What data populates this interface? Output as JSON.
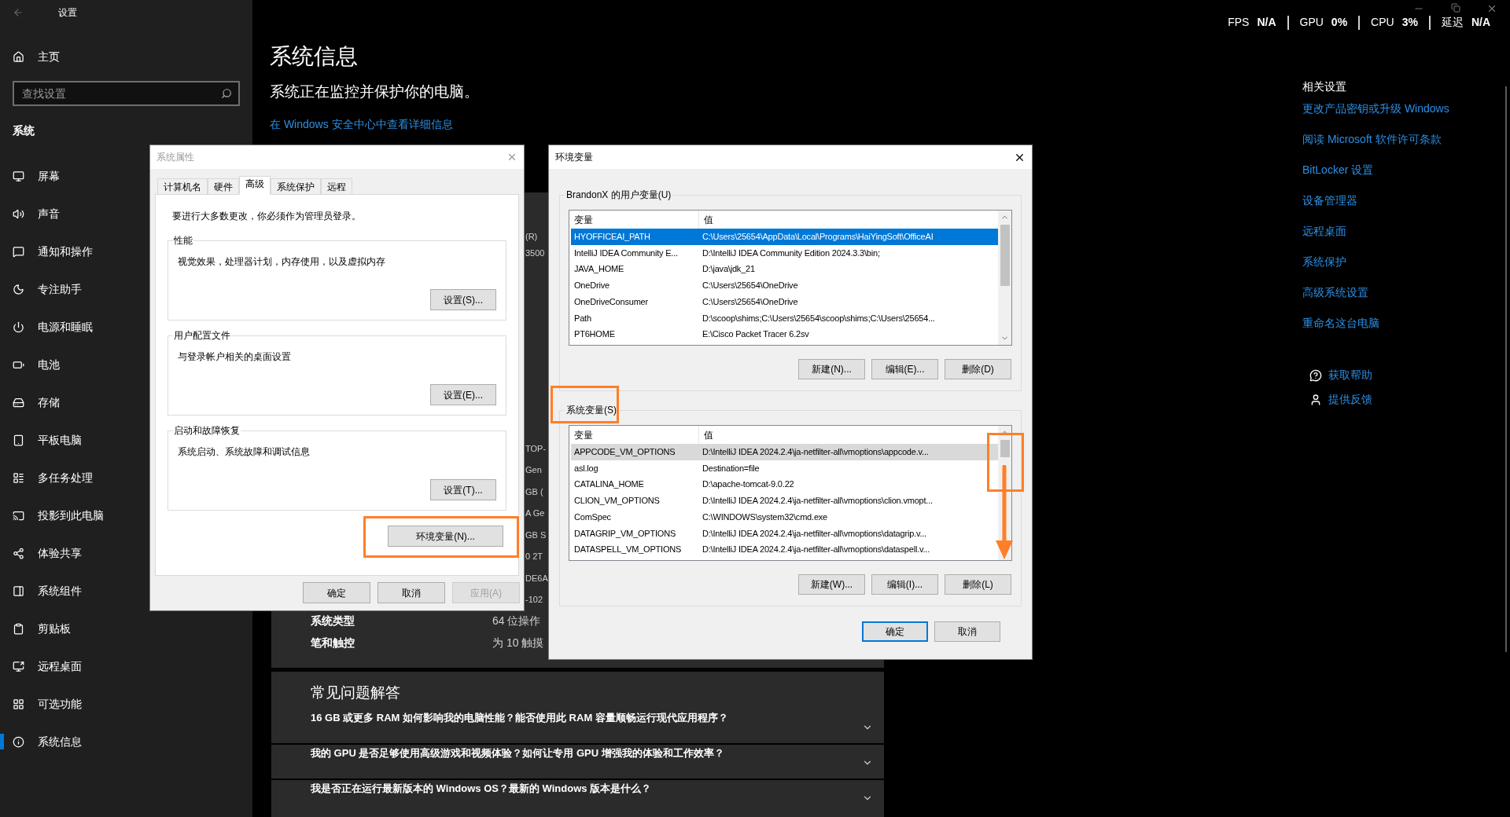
{
  "settings_window": {
    "title": "设置"
  },
  "sidebar": {
    "home": "主页",
    "search": {
      "placeholder": "查找设置"
    },
    "section": "系统",
    "items": [
      {
        "label": "屏幕",
        "selected": false
      },
      {
        "label": "声音",
        "selected": false
      },
      {
        "label": "通知和操作",
        "selected": false
      },
      {
        "label": "专注助手",
        "selected": false
      },
      {
        "label": "电源和睡眠",
        "selected": false
      },
      {
        "label": "电池",
        "selected": false
      },
      {
        "label": "存储",
        "selected": false
      },
      {
        "label": "平板电脑",
        "selected": false
      },
      {
        "label": "多任务处理",
        "selected": false
      },
      {
        "label": "投影到此电脑",
        "selected": false
      },
      {
        "label": "体验共享",
        "selected": false
      },
      {
        "label": "系统组件",
        "selected": false
      },
      {
        "label": "剪贴板",
        "selected": false
      },
      {
        "label": "远程桌面",
        "selected": false
      },
      {
        "label": "可选功能",
        "selected": false
      },
      {
        "label": "系统信息",
        "selected": true
      }
    ]
  },
  "page": {
    "title": "系统信息",
    "subtitle": "系统正在监控并保护你的电脑。",
    "link": "在 Windows 安全中心中查看详细信息"
  },
  "spec_card": {
    "clipped_values": [
      "(R)",
      "3500",
      "TOP-",
      "Gen",
      "GB (",
      "A Ge",
      "GB S",
      "0 2T",
      "DE6A",
      "-102"
    ],
    "rows": [
      {
        "label": "系统类型",
        "value": "64 位操作"
      },
      {
        "label": "笔和触控",
        "value": "为 10 触摸"
      }
    ]
  },
  "faq": {
    "title": "常见问题解答",
    "questions": [
      {
        "text": "16 GB 或更多 RAM 如何影响我的电脑性能？能否使用此 RAM 容量顺畅运行现代应用程序？",
        "expanded": false
      },
      {
        "text": "我的 GPU 是否足够使用高级游戏和视频体验？如何让专用 GPU 增强我的体验和工作效率？",
        "expanded": false
      },
      {
        "text": "我是否正在运行最新版本的 Windows OS？最新的 Windows 版本是什么？",
        "expanded": false
      }
    ]
  },
  "related_settings": {
    "title": "相关设置",
    "links": [
      "更改产品密钥或升级 Windows",
      "阅读 Microsoft 软件许可条款",
      "BitLocker 设置",
      "设备管理器",
      "远程桌面",
      "系统保护",
      "高级系统设置",
      "重命名这台电脑"
    ]
  },
  "support_links": [
    {
      "kind": "help",
      "label": "获取帮助"
    },
    {
      "kind": "feedback",
      "label": "提供反馈"
    }
  ],
  "perf_overlay": [
    {
      "label": "FPS",
      "value": "N/A"
    },
    {
      "label": "GPU",
      "value": "0%"
    },
    {
      "label": "CPU",
      "value": "3%"
    },
    {
      "label": "延迟",
      "value": "N/A"
    }
  ],
  "system_properties": {
    "title": "系统属性",
    "tabs": [
      {
        "label": "计算机名",
        "selected": false
      },
      {
        "label": "硬件",
        "selected": false
      },
      {
        "label": "高级",
        "selected": true
      },
      {
        "label": "系统保护",
        "selected": false
      },
      {
        "label": "远程",
        "selected": false
      }
    ],
    "notice": "要进行大多数更改，你必须作为管理员登录。",
    "groups": [
      {
        "title": "性能",
        "description": "视觉效果，处理器计划，内存使用，以及虚拟内存",
        "button": "设置(S)..."
      },
      {
        "title": "用户配置文件",
        "description": "与登录帐户相关的桌面设置",
        "button": "设置(E)..."
      },
      {
        "title": "启动和故障恢复",
        "description": "系统启动、系统故障和调试信息",
        "button": "设置(T)..."
      }
    ],
    "env_button": "环境变量(N)...",
    "buttons": [
      {
        "label": "确定",
        "disabled": false
      },
      {
        "label": "取消",
        "disabled": false
      },
      {
        "label": "应用(A)",
        "disabled": true
      }
    ]
  },
  "environment_variables": {
    "title": "环境变量",
    "user_vars": {
      "title": "BrandonX 的用户变量(U)",
      "focused": true,
      "columns": [
        "变量",
        "值"
      ],
      "rows": [
        {
          "name": "HYOFFICEAI_PATH",
          "value": "C:\\Users\\25654\\AppData\\Local\\Programs\\HaiYingSoft\\OfficeAI",
          "selected": true
        },
        {
          "name": "IntelliJ IDEA Community E...",
          "value": "D:\\IntelliJ IDEA Community Edition 2024.3.3\\bin;",
          "selected": false
        },
        {
          "name": "JAVA_HOME",
          "value": "D:\\java\\jdk_21",
          "selected": false
        },
        {
          "name": "OneDrive",
          "value": "C:\\Users\\25654\\OneDrive",
          "selected": false
        },
        {
          "name": "OneDriveConsumer",
          "value": "C:\\Users\\25654\\OneDrive",
          "selected": false
        },
        {
          "name": "Path",
          "value": "D:\\scoop\\shims;C:\\Users\\25654\\scoop\\shims;C:\\Users\\25654...",
          "selected": false
        },
        {
          "name": "PT6HOME",
          "value": "E:\\Cisco Packet Tracer 6.2sv",
          "selected": false
        }
      ],
      "buttons": [
        "新建(N)...",
        "编辑(E)...",
        "删除(D)"
      ]
    },
    "system_vars": {
      "title": "系统变量(S)",
      "focused": false,
      "columns": [
        "变量",
        "值"
      ],
      "rows": [
        {
          "name": "APPCODE_VM_OPTIONS",
          "value": "D:\\IntelliJ IDEA 2024.2.4\\ja-netfilter-all\\vmoptions\\appcode.v...",
          "selected": true
        },
        {
          "name": "asl.log",
          "value": "Destination=file",
          "selected": false
        },
        {
          "name": "CATALINA_HOME",
          "value": "D:\\apache-tomcat-9.0.22",
          "selected": false
        },
        {
          "name": "CLION_VM_OPTIONS",
          "value": "D:\\IntelliJ IDEA 2024.2.4\\ja-netfilter-all\\vmoptions\\clion.vmopt...",
          "selected": false
        },
        {
          "name": "ComSpec",
          "value": "C:\\WINDOWS\\system32\\cmd.exe",
          "selected": false
        },
        {
          "name": "DATAGRIP_VM_OPTIONS",
          "value": "D:\\IntelliJ IDEA 2024.2.4\\ja-netfilter-all\\vmoptions\\datagrip.v...",
          "selected": false
        },
        {
          "name": "DATASPELL_VM_OPTIONS",
          "value": "D:\\IntelliJ IDEA 2024.2.4\\ja-netfilter-all\\vmoptions\\dataspell.v...",
          "selected": false
        }
      ],
      "buttons": [
        "新建(W)...",
        "编辑(I)...",
        "删除(L)"
      ]
    },
    "buttons": [
      {
        "label": "确定",
        "default": true
      },
      {
        "label": "取消",
        "default": false
      }
    ]
  }
}
